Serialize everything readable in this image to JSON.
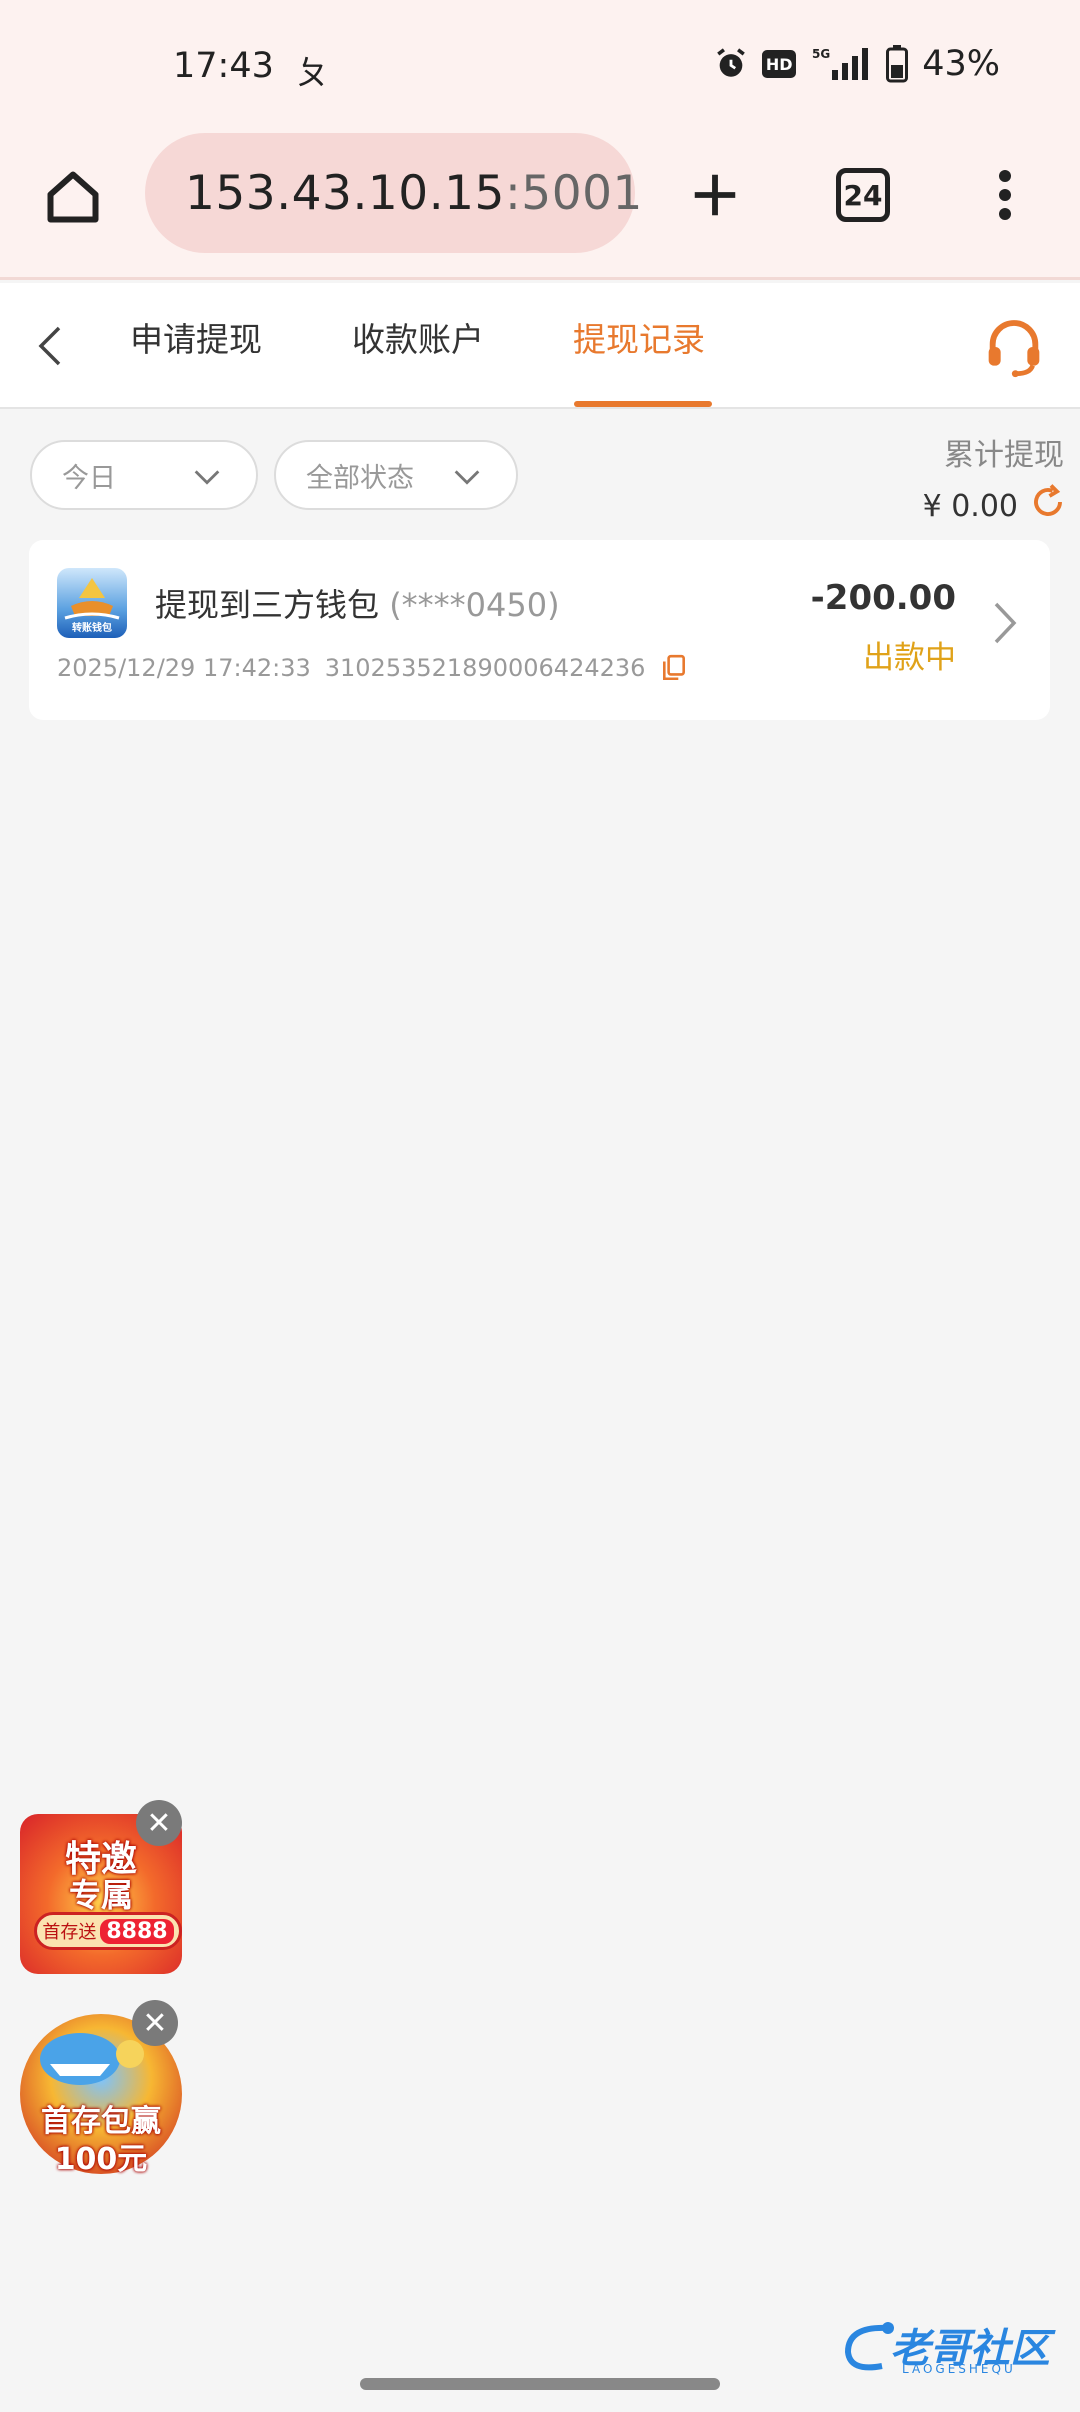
{
  "status_bar": {
    "time": "17:43",
    "extra_glyph": "ㄆ",
    "hd": "HD",
    "network": "5G",
    "battery": "43%"
  },
  "browser": {
    "url_host": "153.43.10.15",
    "url_port": ":5001",
    "tab_count": "24"
  },
  "header": {
    "tabs": [
      {
        "label": "申请提现",
        "active": false
      },
      {
        "label": "收款账户",
        "active": false
      },
      {
        "label": "提现记录",
        "active": true
      }
    ],
    "accent_color": "#e8792e"
  },
  "filters": {
    "date": "今日",
    "status": "全部状态"
  },
  "summary": {
    "label": "累计提现",
    "amount": "¥ 0.00"
  },
  "records": [
    {
      "title": "提现到三方钱包",
      "account_mask": "(****0450)",
      "datetime": "2025/12/29 17:42:33",
      "order_no": "310253521890006424236",
      "amount": "-200.00",
      "status": "出款中",
      "status_color": "#e0a219",
      "logo_text": "转账钱包"
    }
  ],
  "promos": [
    {
      "line1": "特邀",
      "line2": "专属",
      "badge_text": "首存送",
      "badge_value": "8888"
    },
    {
      "line1": "首存包赢",
      "line2": "100元"
    }
  ],
  "watermark": {
    "title": "老哥社区",
    "subtitle": "LAOGESHEQU"
  }
}
